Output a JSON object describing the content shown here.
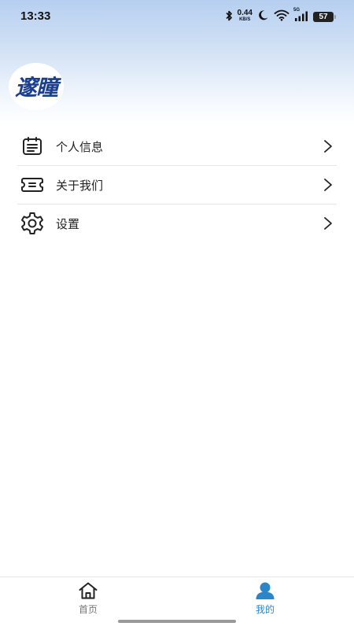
{
  "status_bar": {
    "time": "13:33",
    "net_speed_value": "0.44",
    "net_speed_unit": "KB/S",
    "network_type": "5G",
    "battery_level": "57",
    "icons": [
      "bluetooth-icon",
      "moon-icon",
      "wifi-icon",
      "signal-icon",
      "battery-icon"
    ]
  },
  "profile": {
    "avatar_text": "邃瞳"
  },
  "menu": {
    "items": [
      {
        "label": "个人信息",
        "icon": "profile-card-icon"
      },
      {
        "label": "关于我们",
        "icon": "ticket-icon"
      },
      {
        "label": "设置",
        "icon": "gear-icon"
      }
    ]
  },
  "bottom_nav": {
    "tabs": [
      {
        "label": "首页",
        "icon": "home-icon",
        "active": false
      },
      {
        "label": "我的",
        "icon": "user-icon",
        "active": true
      }
    ]
  },
  "colors": {
    "accent": "#2a86c8",
    "inactive": "#777777",
    "header_top": "#b6cff0"
  }
}
